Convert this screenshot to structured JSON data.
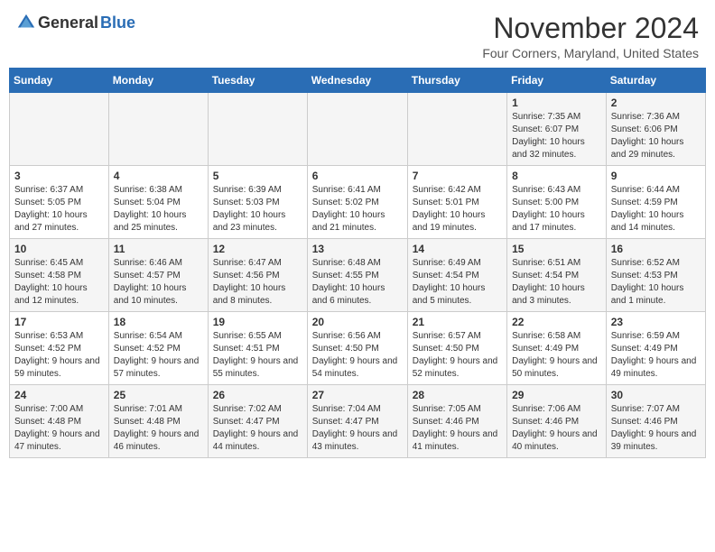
{
  "header": {
    "logo_general": "General",
    "logo_blue": "Blue",
    "month_title": "November 2024",
    "location": "Four Corners, Maryland, United States"
  },
  "days_of_week": [
    "Sunday",
    "Monday",
    "Tuesday",
    "Wednesday",
    "Thursday",
    "Friday",
    "Saturday"
  ],
  "weeks": [
    [
      {
        "day": "",
        "info": ""
      },
      {
        "day": "",
        "info": ""
      },
      {
        "day": "",
        "info": ""
      },
      {
        "day": "",
        "info": ""
      },
      {
        "day": "",
        "info": ""
      },
      {
        "day": "1",
        "info": "Sunrise: 7:35 AM\nSunset: 6:07 PM\nDaylight: 10 hours and 32 minutes."
      },
      {
        "day": "2",
        "info": "Sunrise: 7:36 AM\nSunset: 6:06 PM\nDaylight: 10 hours and 29 minutes."
      }
    ],
    [
      {
        "day": "3",
        "info": "Sunrise: 6:37 AM\nSunset: 5:05 PM\nDaylight: 10 hours and 27 minutes."
      },
      {
        "day": "4",
        "info": "Sunrise: 6:38 AM\nSunset: 5:04 PM\nDaylight: 10 hours and 25 minutes."
      },
      {
        "day": "5",
        "info": "Sunrise: 6:39 AM\nSunset: 5:03 PM\nDaylight: 10 hours and 23 minutes."
      },
      {
        "day": "6",
        "info": "Sunrise: 6:41 AM\nSunset: 5:02 PM\nDaylight: 10 hours and 21 minutes."
      },
      {
        "day": "7",
        "info": "Sunrise: 6:42 AM\nSunset: 5:01 PM\nDaylight: 10 hours and 19 minutes."
      },
      {
        "day": "8",
        "info": "Sunrise: 6:43 AM\nSunset: 5:00 PM\nDaylight: 10 hours and 17 minutes."
      },
      {
        "day": "9",
        "info": "Sunrise: 6:44 AM\nSunset: 4:59 PM\nDaylight: 10 hours and 14 minutes."
      }
    ],
    [
      {
        "day": "10",
        "info": "Sunrise: 6:45 AM\nSunset: 4:58 PM\nDaylight: 10 hours and 12 minutes."
      },
      {
        "day": "11",
        "info": "Sunrise: 6:46 AM\nSunset: 4:57 PM\nDaylight: 10 hours and 10 minutes."
      },
      {
        "day": "12",
        "info": "Sunrise: 6:47 AM\nSunset: 4:56 PM\nDaylight: 10 hours and 8 minutes."
      },
      {
        "day": "13",
        "info": "Sunrise: 6:48 AM\nSunset: 4:55 PM\nDaylight: 10 hours and 6 minutes."
      },
      {
        "day": "14",
        "info": "Sunrise: 6:49 AM\nSunset: 4:54 PM\nDaylight: 10 hours and 5 minutes."
      },
      {
        "day": "15",
        "info": "Sunrise: 6:51 AM\nSunset: 4:54 PM\nDaylight: 10 hours and 3 minutes."
      },
      {
        "day": "16",
        "info": "Sunrise: 6:52 AM\nSunset: 4:53 PM\nDaylight: 10 hours and 1 minute."
      }
    ],
    [
      {
        "day": "17",
        "info": "Sunrise: 6:53 AM\nSunset: 4:52 PM\nDaylight: 9 hours and 59 minutes."
      },
      {
        "day": "18",
        "info": "Sunrise: 6:54 AM\nSunset: 4:52 PM\nDaylight: 9 hours and 57 minutes."
      },
      {
        "day": "19",
        "info": "Sunrise: 6:55 AM\nSunset: 4:51 PM\nDaylight: 9 hours and 55 minutes."
      },
      {
        "day": "20",
        "info": "Sunrise: 6:56 AM\nSunset: 4:50 PM\nDaylight: 9 hours and 54 minutes."
      },
      {
        "day": "21",
        "info": "Sunrise: 6:57 AM\nSunset: 4:50 PM\nDaylight: 9 hours and 52 minutes."
      },
      {
        "day": "22",
        "info": "Sunrise: 6:58 AM\nSunset: 4:49 PM\nDaylight: 9 hours and 50 minutes."
      },
      {
        "day": "23",
        "info": "Sunrise: 6:59 AM\nSunset: 4:49 PM\nDaylight: 9 hours and 49 minutes."
      }
    ],
    [
      {
        "day": "24",
        "info": "Sunrise: 7:00 AM\nSunset: 4:48 PM\nDaylight: 9 hours and 47 minutes."
      },
      {
        "day": "25",
        "info": "Sunrise: 7:01 AM\nSunset: 4:48 PM\nDaylight: 9 hours and 46 minutes."
      },
      {
        "day": "26",
        "info": "Sunrise: 7:02 AM\nSunset: 4:47 PM\nDaylight: 9 hours and 44 minutes."
      },
      {
        "day": "27",
        "info": "Sunrise: 7:04 AM\nSunset: 4:47 PM\nDaylight: 9 hours and 43 minutes."
      },
      {
        "day": "28",
        "info": "Sunrise: 7:05 AM\nSunset: 4:46 PM\nDaylight: 9 hours and 41 minutes."
      },
      {
        "day": "29",
        "info": "Sunrise: 7:06 AM\nSunset: 4:46 PM\nDaylight: 9 hours and 40 minutes."
      },
      {
        "day": "30",
        "info": "Sunrise: 7:07 AM\nSunset: 4:46 PM\nDaylight: 9 hours and 39 minutes."
      }
    ]
  ]
}
